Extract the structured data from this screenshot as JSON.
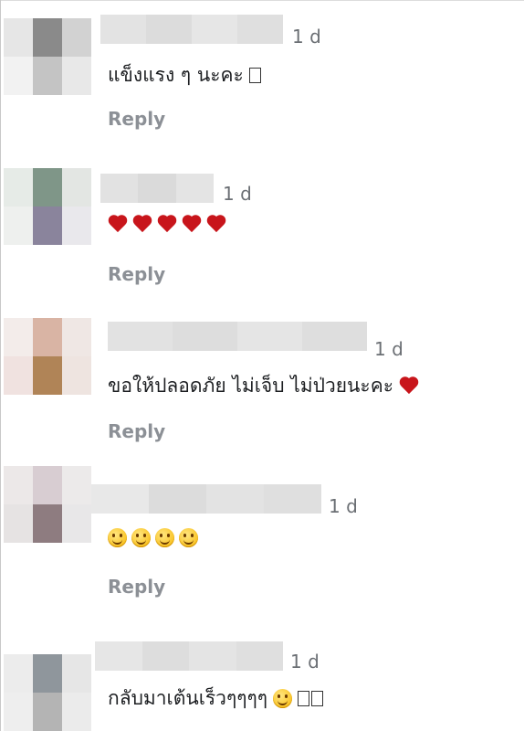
{
  "comments": [
    {
      "time": "1 d",
      "text": "แข็งแรง ๆ นะคะ",
      "trailing_glyph": "box",
      "reply": "Reply"
    },
    {
      "time": "1 d",
      "emoji": "heart",
      "emoji_count": 5,
      "reply": "Reply"
    },
    {
      "time": "1 d",
      "text": "ขอให้ปลอดภัย ไม่เจ็บ ไม่ป่วยนะคะ",
      "trailing_emoji": "heart",
      "reply": "Reply"
    },
    {
      "time": "1 d",
      "emoji": "smiley",
      "emoji_count": 4,
      "reply": "Reply"
    },
    {
      "time": "1 d",
      "text": "กลับมาเต้นเร็วๆๆๆๆ",
      "trailing_emoji": "smiley",
      "trailing_glyphs": "box-box"
    }
  ],
  "colors": {
    "reply": "#8c9096",
    "timestamp": "#6b6f74",
    "heart": "#c8151b",
    "text": "#1c1e21"
  }
}
